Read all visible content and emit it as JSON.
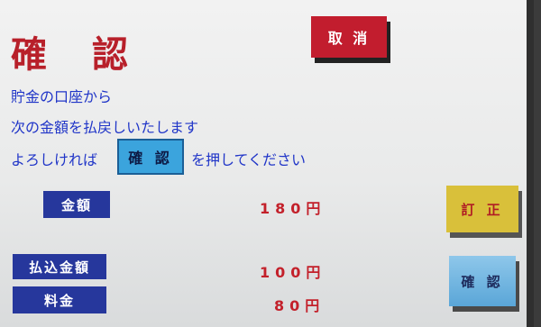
{
  "header": {
    "title": "確 認",
    "cancel_label": "取 消"
  },
  "message": {
    "line1": "貯金の口座から",
    "line2": "次の金額を払戻しいたします",
    "line3_before": "よろしければ",
    "confirm_inline_label": "確 認",
    "line3_after": "を押してください"
  },
  "details": {
    "amount_label": "金額",
    "amount_value": "180円",
    "transfer_label": "払込金額",
    "transfer_value": "100円",
    "fee_label": "料金",
    "fee_value": "80円"
  },
  "actions": {
    "correct_label": "訂 正",
    "confirm_label": "確 認"
  },
  "colors": {
    "title_red": "#b8202a",
    "cancel_red": "#c21d2e",
    "message_blue": "#2035c8",
    "label_navy": "#26379c",
    "value_red": "#c3202a",
    "correct_yellow": "#d9c03a",
    "confirm_blue": "#5aa6d8"
  }
}
